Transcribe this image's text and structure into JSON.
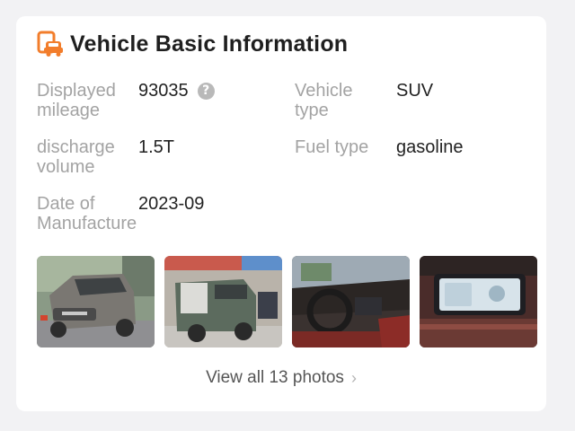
{
  "section": {
    "title": "Vehicle Basic Information",
    "icon": "car-document-icon",
    "accent_color": "#f27d2b"
  },
  "fields": {
    "mileage": {
      "label_line1": "Displayed",
      "label_line2": "mileage",
      "value": "93035"
    },
    "type": {
      "label_line1": "Vehicle",
      "label_line2": "type",
      "value": "SUV"
    },
    "discharge": {
      "label_line1": "discharge",
      "label_line2": "volume",
      "value": "1.5T"
    },
    "fuel": {
      "label_line1": "Fuel type",
      "label_line2": "",
      "value": "gasoline"
    },
    "date": {
      "label_line1": "Date of",
      "label_line2": "Manufacture",
      "value": "2023-09"
    }
  },
  "help_icon": {
    "glyph": "?",
    "icon": "question-circle-icon"
  },
  "photos": [
    {
      "name": "photo-exterior-front"
    },
    {
      "name": "photo-exterior-rear"
    },
    {
      "name": "photo-interior-steering"
    },
    {
      "name": "photo-interior-dashboard"
    }
  ],
  "view_all": {
    "label": "View all 13 photos",
    "chevron": "›"
  }
}
